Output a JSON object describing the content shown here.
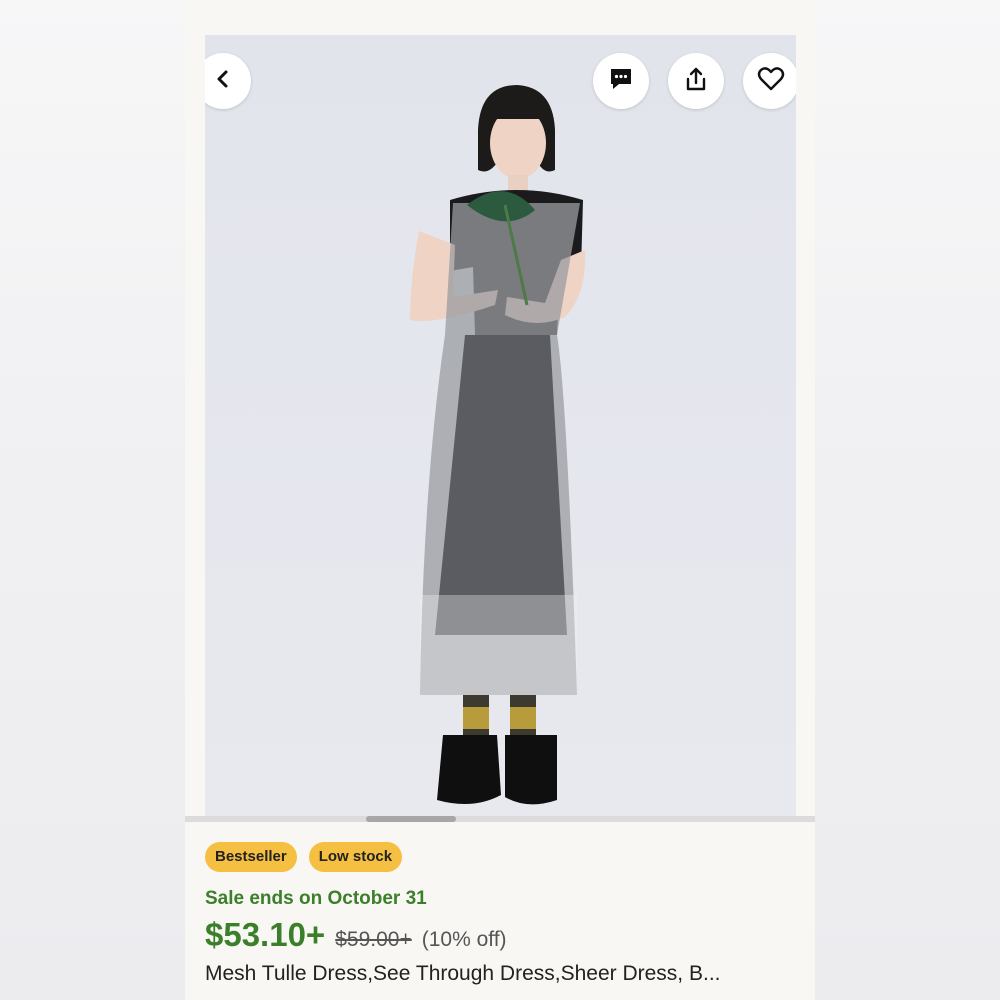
{
  "listing": {
    "badges": [
      "Bestseller",
      "Low stock"
    ],
    "sale_text": "Sale ends on October 31",
    "price": "$53.10+",
    "original_price": "$59.00+",
    "discount": "(10% off)",
    "title": "Mesh Tulle Dress,See Through Dress,Sheer Dress, B..."
  },
  "icons": {
    "back": "chevron-left-icon",
    "message": "message-icon",
    "share": "share-icon",
    "favorite": "heart-icon"
  },
  "colors": {
    "sale_green": "#3b7f2a",
    "badge_yellow": "#f5c042"
  }
}
